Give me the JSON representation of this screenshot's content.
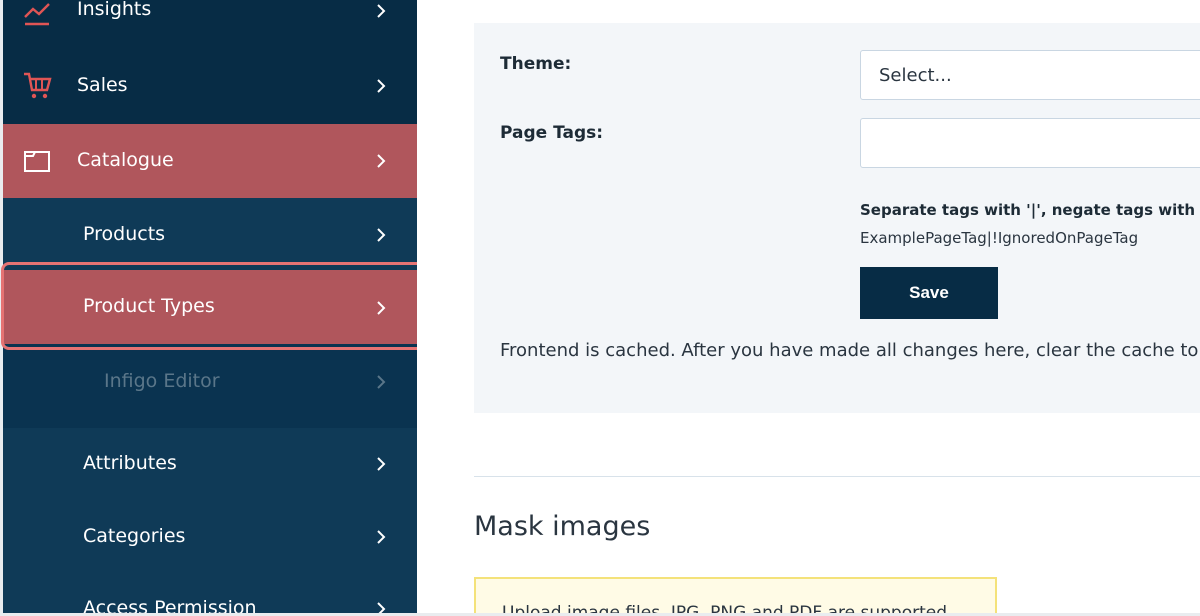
{
  "sidebar": {
    "items": [
      {
        "label": "Insights",
        "icon": "chart-line-icon"
      },
      {
        "label": "Sales",
        "icon": "cart-icon"
      },
      {
        "label": "Catalogue",
        "icon": "folder-icon"
      }
    ],
    "subitems": [
      {
        "label": "Products"
      },
      {
        "label": "Product Types"
      },
      {
        "label": "Infigo Editor"
      },
      {
        "label": "Attributes"
      },
      {
        "label": "Categories"
      },
      {
        "label": "Access Permission"
      }
    ]
  },
  "form": {
    "theme_label": "Theme:",
    "theme_value": "Select...",
    "page_tags_label": "Page Tags:",
    "page_tags_value": "",
    "hint_strong": "Separate tags with '|', negate tags with !:",
    "hint_example": "ExamplePageTag|!IgnoredOnPageTag",
    "save_label": "Save",
    "cache_note": "Frontend is cached. After you have made all changes here, clear the cache to m"
  },
  "mask": {
    "title": "Mask images",
    "notice": "Upload image files. JPG, PNG and PDF are supported"
  },
  "colors": {
    "sidebar_bg": "#0f3a57",
    "active_bg": "#b0565c",
    "button_bg": "#072c45",
    "highlight_border": "#e57373",
    "icon_red": "#e05555"
  }
}
